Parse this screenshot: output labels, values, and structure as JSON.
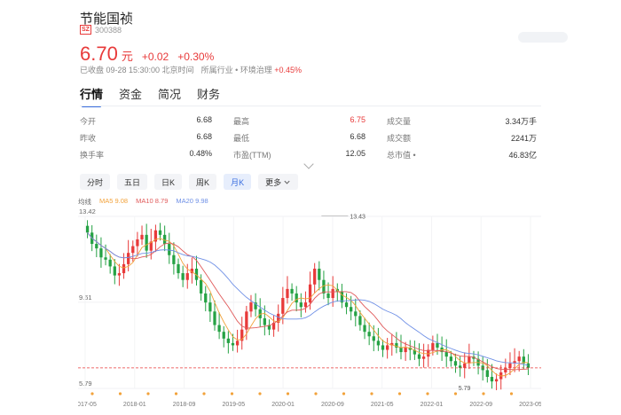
{
  "stock": {
    "name": "节能国祯",
    "market": "SZ",
    "code": "300388",
    "price": "6.70",
    "unit": "元",
    "change": "+0.02",
    "change_pct": "+0.30%",
    "status": "已收盘 09-28 15:30:00 北京时间",
    "industry_label": "所属行业 •",
    "industry": "环境治理",
    "industry_change": "+0.45%"
  },
  "tabs": [
    "行情",
    "资金",
    "简况",
    "财务"
  ],
  "stats": [
    [
      {
        "label": "今开",
        "value": "6.68"
      },
      {
        "label": "最高",
        "value": "6.75",
        "red": true
      },
      {
        "label": "成交量",
        "value": "3.34万手"
      }
    ],
    [
      {
        "label": "昨收",
        "value": "6.68"
      },
      {
        "label": "最低",
        "value": "6.68"
      },
      {
        "label": "成交额",
        "value": "2241万"
      }
    ],
    [
      {
        "label": "换手率",
        "value": "0.48%"
      },
      {
        "label": "市盈(TTM)",
        "value": "12.05"
      },
      {
        "label": "总市值 •",
        "value": "46.83亿"
      }
    ]
  ],
  "periods": [
    "分时",
    "五日",
    "日K",
    "周K",
    "月K",
    "更多"
  ],
  "active_period": "月K",
  "legend": {
    "label": "均线",
    "ma5": "MA5 9.08",
    "ma10": "MA10 8.79",
    "ma20": "MA20 9.98"
  },
  "colors": {
    "up": "#e83a3a",
    "down": "#25a244",
    "ma5": "#f2a23b",
    "ma10": "#e05a5a",
    "ma20": "#6f90e6",
    "accent": "#3b6fe0"
  },
  "chart_data": {
    "type": "candlestick",
    "y_ticks": [
      "13.42",
      "9.61",
      "5.79"
    ],
    "x_labels": [
      "2017-05",
      "2018-01",
      "2018-09",
      "2019-05",
      "2020-01",
      "2020-09",
      "2021-05",
      "2022-01",
      "2022-09",
      "2023-05"
    ],
    "max_label": "13.43",
    "min_label": "5.79",
    "last_close": 6.7,
    "closes": [
      12.7,
      12.2,
      12.0,
      11.6,
      11.5,
      11.2,
      10.8,
      10.9,
      11.3,
      11.8,
      12.1,
      12.4,
      12.6,
      11.9,
      12.3,
      12.8,
      12.6,
      12.2,
      11.7,
      11.3,
      10.9,
      10.6,
      10.9,
      11.1,
      10.6,
      10.0,
      9.6,
      9.2,
      8.6,
      8.3,
      8.0,
      7.8,
      7.7,
      7.9,
      8.4,
      9.2,
      9.6,
      9.3,
      8.9,
      8.6,
      8.4,
      8.7,
      9.1,
      9.8,
      10.2,
      10.0,
      9.6,
      9.4,
      9.6,
      10.4,
      11.1,
      10.6,
      10.0,
      9.8,
      10.2,
      10.1,
      9.6,
      9.4,
      9.2,
      9.0,
      8.6,
      8.3,
      8.1,
      7.9,
      7.7,
      7.5,
      7.7,
      7.8,
      7.6,
      7.4,
      7.6,
      7.5,
      7.3,
      7.1,
      7.2,
      7.5,
      7.8,
      7.6,
      7.4,
      7.2,
      7.0,
      6.8,
      6.7,
      6.9,
      7.2,
      7.1,
      6.8,
      6.6,
      6.3,
      6.1,
      6.2,
      6.5,
      6.7,
      6.9,
      7.0,
      7.2,
      6.9,
      6.7
    ]
  }
}
